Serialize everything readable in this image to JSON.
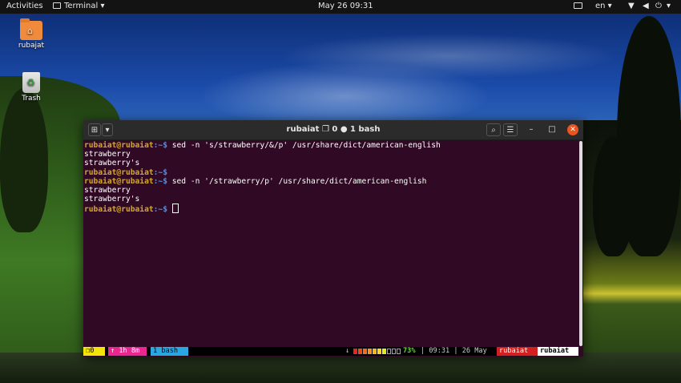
{
  "topbar": {
    "activities": "Activities",
    "app_menu": "Terminal ▾",
    "clock": "May 26  09:31",
    "language": "en ▾",
    "status_icons": [
      "screenshot-icon",
      "wifi-icon",
      "volume-icon",
      "power-icon",
      "chevron-down-icon"
    ]
  },
  "desktop_icons": {
    "home_label": "rubajat",
    "trash_label": "Trash"
  },
  "window": {
    "title": "rubaiat ❐ 0 ● 1 bash",
    "new_tab_icon": "new-tab-icon",
    "menu_icon": "hamburger-menu-icon"
  },
  "terminal": {
    "prompt_user": "rubaiat@rubaiat",
    "prompt_path": ":~$",
    "lines": [
      {
        "type": "cmd",
        "text": " sed -n 's/strawberry/&/p' /usr/share/dict/american-english"
      },
      {
        "type": "out",
        "text": "strawberry"
      },
      {
        "type": "out",
        "text": "strawberry's"
      },
      {
        "type": "cmd",
        "text": ""
      },
      {
        "type": "cmd",
        "text": " sed -n '/strawberry/p' /usr/share/dict/american-english"
      },
      {
        "type": "out",
        "text": "strawberry"
      },
      {
        "type": "out",
        "text": "strawberry's"
      },
      {
        "type": "cmd",
        "text": " ",
        "cursor": true
      }
    ]
  },
  "statusbar": {
    "session": "0",
    "uptime": "↑ 1h 8m",
    "window": "1 bash",
    "arrow": "↓",
    "battery": "73%",
    "battery_level": 0.73,
    "time": "| 09:31 | 26 May",
    "host": "rubaiat",
    "user": "rubaiat",
    "colors": {
      "session": "#f4e409",
      "uptime": "#e8278f",
      "window": "#2aa7e0",
      "battery": "#5bde2f",
      "host": "#d21f1f",
      "user": "#ffffff"
    }
  }
}
